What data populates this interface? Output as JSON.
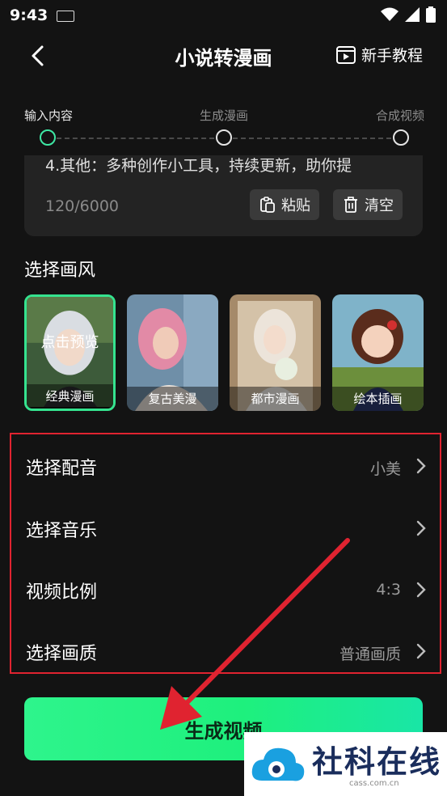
{
  "status_bar": {
    "time": "9:43"
  },
  "header": {
    "title": "小说转漫画",
    "tutorial_label": "新手教程"
  },
  "steps": [
    {
      "label": "输入内容",
      "active": true
    },
    {
      "label": "生成漫画",
      "active": false
    },
    {
      "label": "合成视频",
      "active": false
    }
  ],
  "text_input": {
    "snippet": "4.其他：多种创作小工具，持续更新，助你提",
    "count": "120/6000",
    "paste_label": "粘贴",
    "clear_label": "清空"
  },
  "style_section": {
    "title": "选择画风",
    "preview_label": "点击预览",
    "items": [
      {
        "label": "经典漫画",
        "selected": true
      },
      {
        "label": "复古美漫",
        "selected": false
      },
      {
        "label": "都市漫画",
        "selected": false
      },
      {
        "label": "绘本插画",
        "selected": false
      }
    ]
  },
  "settings": [
    {
      "label": "选择配音",
      "value": "小美"
    },
    {
      "label": "选择音乐",
      "value": ""
    },
    {
      "label": "视频比例",
      "value": "4:3"
    },
    {
      "label": "选择画质",
      "value": "普通画质"
    }
  ],
  "generate_button": {
    "label": "生成视频"
  },
  "watermark": {
    "name": "社科在线",
    "url": "cass.com.cn"
  },
  "colors": {
    "accent": "#35e38f",
    "annotation_red": "#e02330",
    "background": "#131313"
  },
  "icons": [
    "keyboard-icon",
    "wifi-icon",
    "signal-icon",
    "battery-icon",
    "back-icon",
    "tutorial-icon",
    "paste-icon",
    "trash-icon",
    "chevron-right-icon"
  ]
}
